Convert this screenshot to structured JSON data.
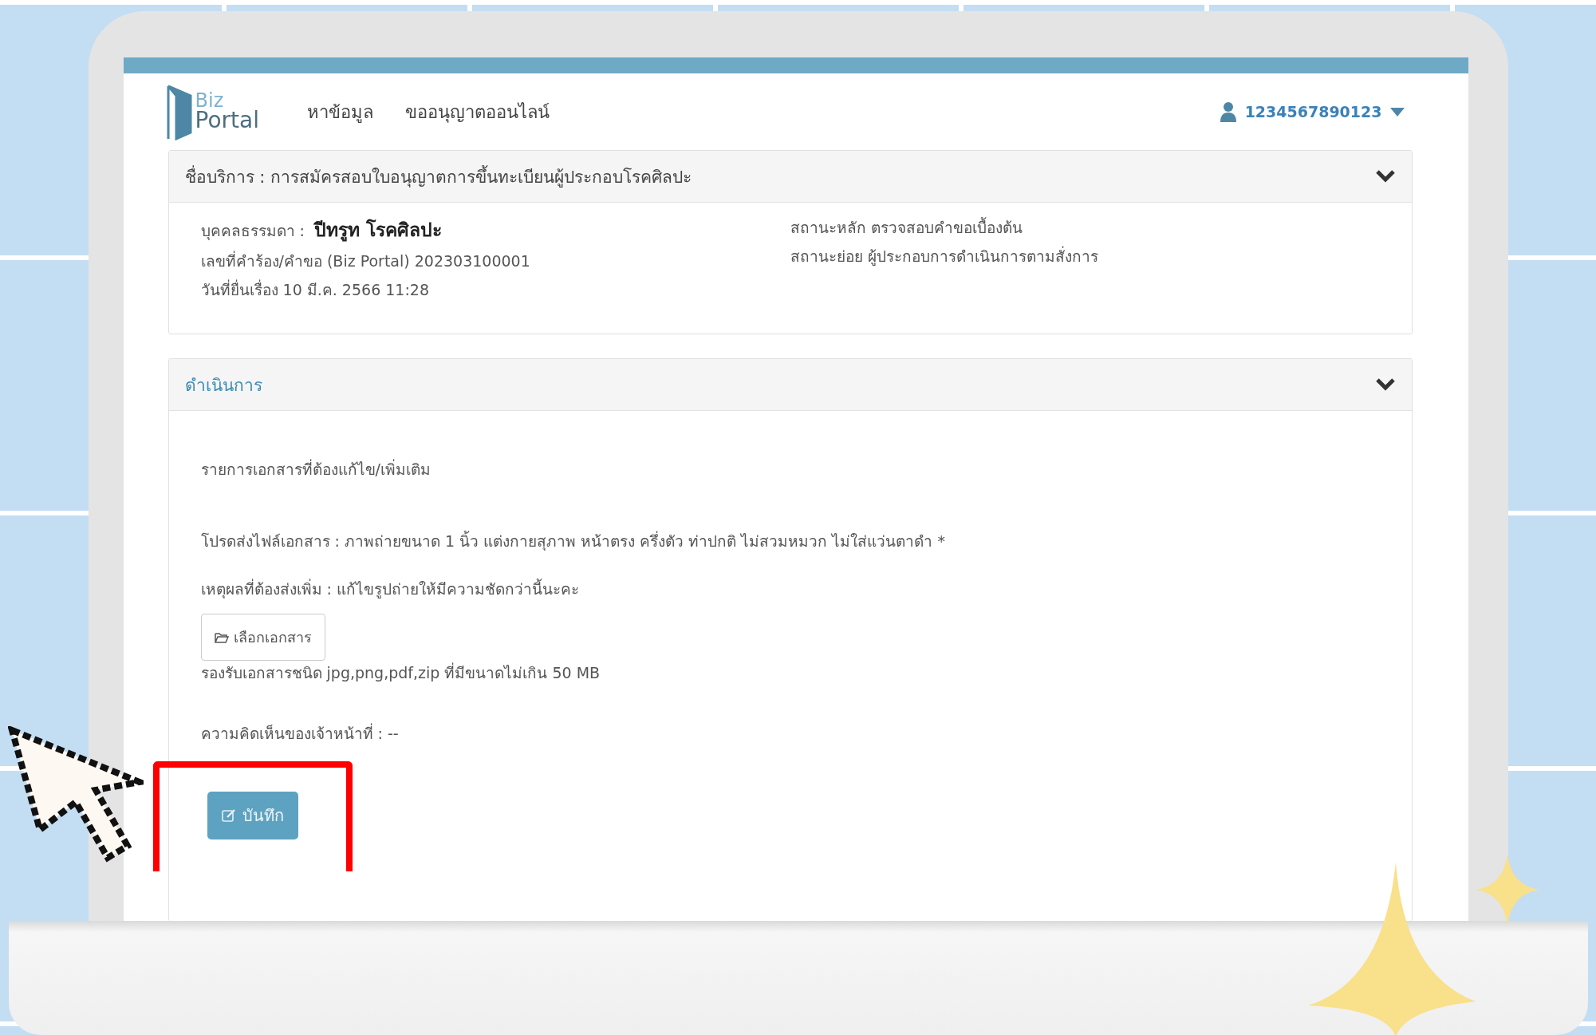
{
  "header": {
    "logo": [
      "Biz",
      "Portal"
    ],
    "nav": [
      "หาข้อมูล",
      "ขออนุญาตออนไลน์"
    ],
    "user": "1234567890123"
  },
  "service_panel": {
    "title": "ชื่อบริการ : การสมัครสอบใบอนุญาตการขึ้นทะเบียนผู้ประกอบโรคศิลปะ",
    "person_label": "บุคคลธรรมดา :",
    "person_name": "ปีทรูท โรคศิลปะ",
    "request_no": "เลขที่คำร้อง/คำขอ (Biz Portal) 202303100001",
    "filed": "วันที่ยื่นเรื่อง 10 มี.ค. 2566 11:28",
    "main_status": "สถานะหลัก ตรวจสอบคำขอเบื้องต้น",
    "sub_status": "สถานะย่อย ผู้ประกอบการดำเนินการตามสั่งการ"
  },
  "action_panel": {
    "title": "ดำเนินการ",
    "heading": "รายการเอกสารที่ต้องแก้ไข/เพิ่มเติม",
    "document": "โปรดส่งไฟล์เอกสาร : ภาพถ่ายขนาด 1 นิ้ว แต่งกายสุภาพ หน้าตรง ครึ่งตัว ท่าปกติ ไม่สวมหมวก ไม่ใส่แว่นตาดำ *",
    "reason": "เหตุผลที่ต้องส่งเพิ่ม : แก้ไขรูปถ่ายให้มีความชัดกว่านี้นะคะ",
    "choose_button": "เลือกเอกสาร",
    "file_hint": "รองรับเอกสารชนิด jpg,png,pdf,zip ที่มีขนาดไม่เกิน 50 MB",
    "comment": "ความคิดเห็นของเจ้าหน้าที่ : --",
    "save_button": "บันทึก"
  }
}
